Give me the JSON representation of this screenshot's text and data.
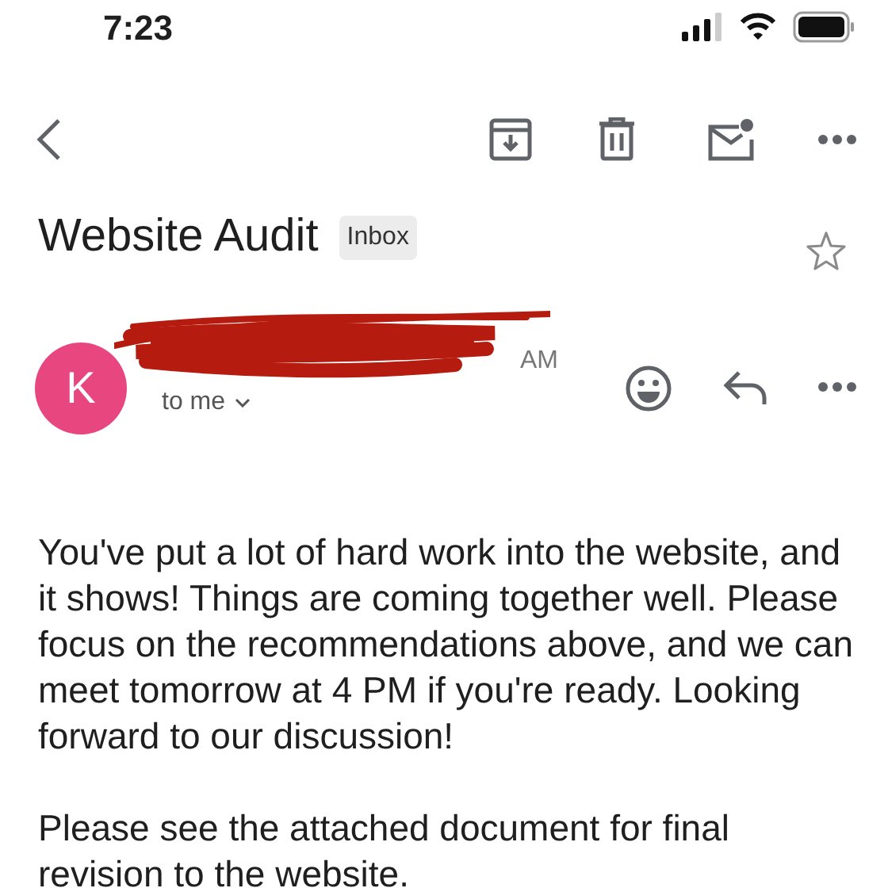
{
  "status_bar": {
    "time": "7:23"
  },
  "email": {
    "subject": "Website Audit",
    "label": "Inbox",
    "starred": false,
    "sender": {
      "initial": "K",
      "color": "#e8467f",
      "time_fragment": "AM",
      "recipient": "to me"
    },
    "body": [
      "You've put a lot of hard work into the website, and it shows! Things are coming together well. Please focus on the recommendations above, and we can meet tomorrow at 4 PM if you're ready. Looking forward to our discussion!",
      "Please see the attached document for final revision to the website."
    ]
  }
}
